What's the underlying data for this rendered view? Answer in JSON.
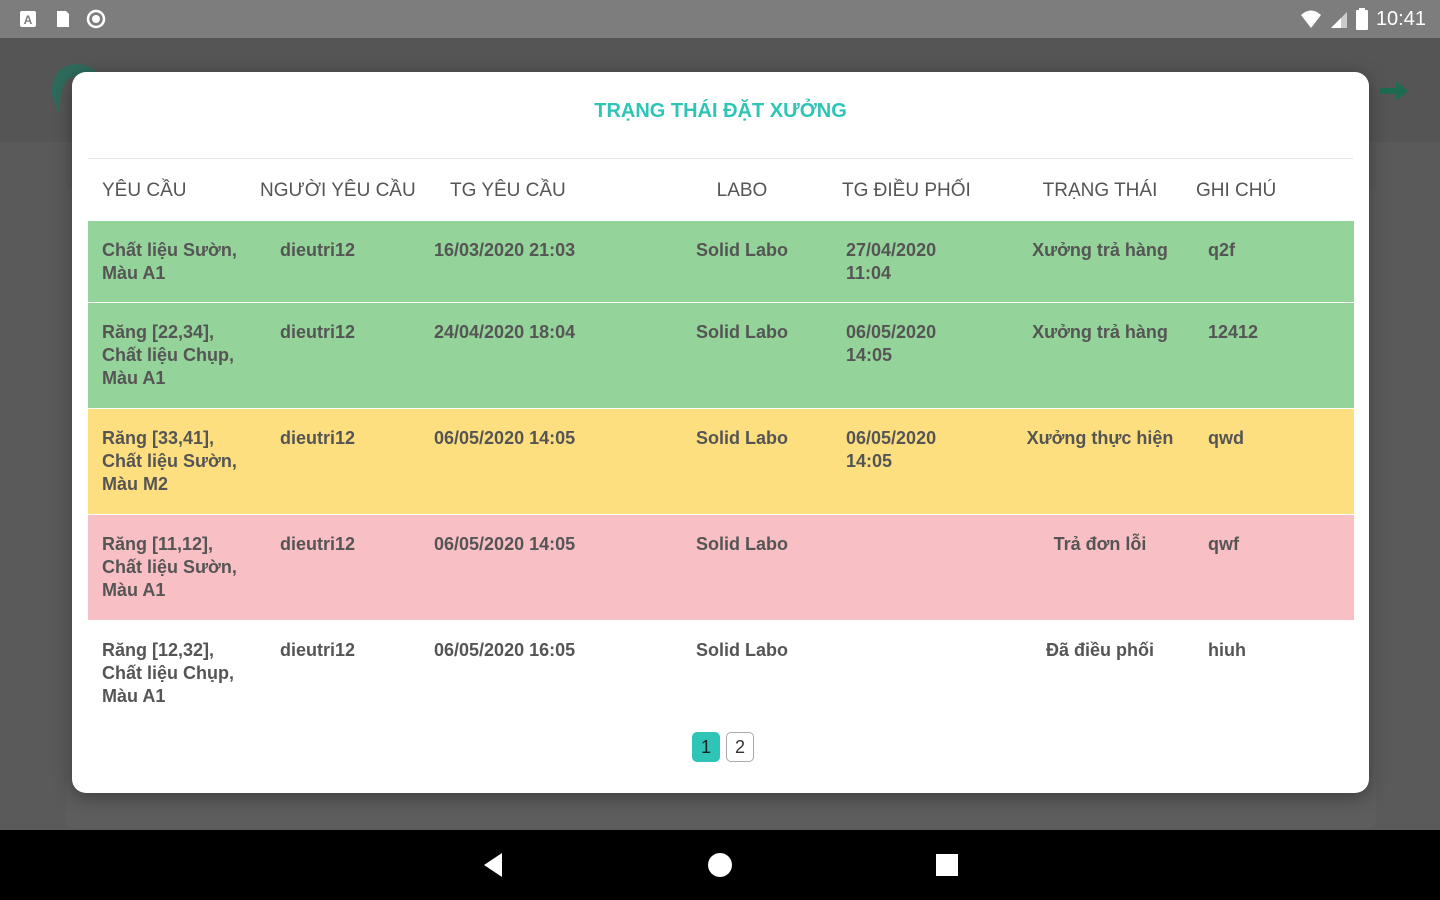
{
  "status_bar": {
    "time": "10:41",
    "left_icons": [
      "a-icon",
      "sd-card-icon",
      "circle-icon"
    ],
    "right_icons": [
      "wifi-icon",
      "signal-icon",
      "battery-icon"
    ]
  },
  "modal": {
    "title": "TRẠNG THÁI ĐẶT XƯỞNG",
    "columns": [
      "YÊU CẦU",
      "NGƯỜI YÊU CẦU",
      "TG YÊU CẦU",
      "LABO",
      "TG ĐIỀU PHỐI",
      "TRẠNG THÁI",
      "GHI CHÚ"
    ],
    "rows": [
      {
        "status_color": "green",
        "request": [
          "Chất liệu Sườn,",
          "Màu A1"
        ],
        "requester": "dieutri12",
        "request_time": "16/03/2020 21:03",
        "labo": "Solid Labo",
        "dispatch_time": [
          "27/04/2020",
          "11:04"
        ],
        "status": "Xưởng trả hàng",
        "note": "q2f"
      },
      {
        "status_color": "green",
        "request": [
          "Răng [22,34],",
          "Chất liệu Chụp,",
          "Màu A1"
        ],
        "requester": "dieutri12",
        "request_time": "24/04/2020 18:04",
        "labo": "Solid Labo",
        "dispatch_time": [
          "06/05/2020",
          "14:05"
        ],
        "status": "Xưởng trả hàng",
        "note": "12412"
      },
      {
        "status_color": "yellow",
        "request": [
          "Răng [33,41],",
          "Chất liệu Sườn,",
          "Màu M2"
        ],
        "requester": "dieutri12",
        "request_time": "06/05/2020 14:05",
        "labo": "Solid Labo",
        "dispatch_time": [
          "06/05/2020",
          "14:05"
        ],
        "status": "Xưởng thực hiện",
        "note": "qwd"
      },
      {
        "status_color": "pink",
        "request": [
          "Răng [11,12],",
          "Chất liệu Sườn,",
          "Màu A1"
        ],
        "requester": "dieutri12",
        "request_time": "06/05/2020 14:05",
        "labo": "Solid Labo",
        "dispatch_time": [
          "",
          ""
        ],
        "status": "Trả đơn lỗi",
        "note": "qwf"
      },
      {
        "status_color": "white",
        "request": [
          "Răng [12,32],",
          "Chất liệu Chụp,",
          "Màu A1"
        ],
        "requester": "dieutri12",
        "request_time": "06/05/2020 16:05",
        "labo": "Solid Labo",
        "dispatch_time": [
          "",
          ""
        ],
        "status": "Đã điều phối",
        "note": "hiuh"
      }
    ],
    "pagination": {
      "pages": [
        "1",
        "2"
      ],
      "current": "1"
    }
  },
  "colors": {
    "accent": "#2ec4b6",
    "row_green": "#94d39a",
    "row_yellow": "#fedf80",
    "row_pink": "#f8bfc5"
  },
  "nav_bar": {
    "icons": [
      "back-icon",
      "home-icon",
      "recents-icon"
    ]
  }
}
